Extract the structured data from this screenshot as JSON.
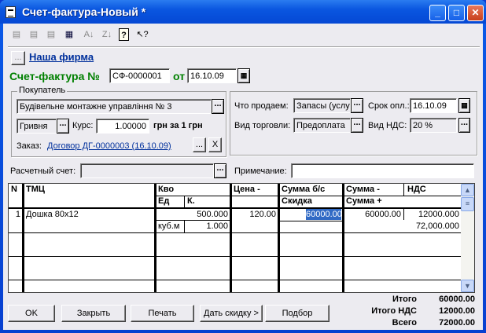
{
  "window": {
    "title": "Счет-фактура-Новый *",
    "minimize": "_",
    "maximize": "□",
    "close": "✕"
  },
  "toolbar": {
    "icons": [
      "new-row-icon",
      "add-row-icon",
      "delete-row-icon",
      "save-icon",
      "sort-asc-icon",
      "sort-desc-icon",
      "help-icon",
      "context-help-icon"
    ]
  },
  "firm": {
    "button": "...",
    "link": "Наша фирма"
  },
  "invoice": {
    "label": "Счет-фактура №",
    "number": "СФ-0000001",
    "date_label": "от",
    "date": "16.10.09"
  },
  "buyer": {
    "group_label": "Покупатель",
    "name": "Будівельне монтажне управління № 3",
    "currency": "Гривня",
    "rate_label": "Курс:",
    "rate": "1.00000",
    "rate_unit": "грн за 1 грн",
    "order_label": "Заказ:",
    "order_link": "Договор ДГ-0000003 (16.10.09)",
    "clear": "X"
  },
  "sale": {
    "what_label": "Что продаем:",
    "what": "Запасы (услу",
    "term_label": "Срок опл.:",
    "term": "16.10.09",
    "trade_label": "Вид торговли:",
    "trade": "Предоплата",
    "vat_label": "Вид НДС:",
    "vat": "20 %"
  },
  "account": {
    "label": "Расчетный счет:",
    "value": "",
    "note_label": "Примечание:",
    "note": ""
  },
  "table": {
    "headers": {
      "n": "N",
      "item": "ТМЦ",
      "qty": "Кво",
      "unit": "Ед",
      "k": "К.",
      "price": "Цена -",
      "sum_bs": "Сумма б/с",
      "discount": "Скидка",
      "sum_minus": "Сумма -",
      "vat": "НДС",
      "sum_plus": "Сумма +"
    },
    "rows": [
      {
        "n": "1",
        "item": "Дошка 80x12",
        "qty": "500.000",
        "unit": "куб.м",
        "k": "1.000",
        "price": "120.00",
        "sum_bs": "60000.00",
        "discount": "",
        "sum_minus": "60000.00",
        "vat": "12000.000",
        "sum_plus": "72,000.000"
      }
    ]
  },
  "buttons": {
    "ok": "OK",
    "close": "Закрыть",
    "print": "Печать",
    "discount": "Дать скидку >",
    "select": "Подбор"
  },
  "totals": {
    "total_label": "Итого",
    "total": "60000.00",
    "vat_label": "Итого НДС",
    "vat": "12000.00",
    "all_label": "Всего",
    "all": "72000.00"
  },
  "colors": {
    "title_bar": "#0a56e0",
    "label_green": "#008000",
    "link": "#00309c",
    "selection": "#316ac5"
  }
}
